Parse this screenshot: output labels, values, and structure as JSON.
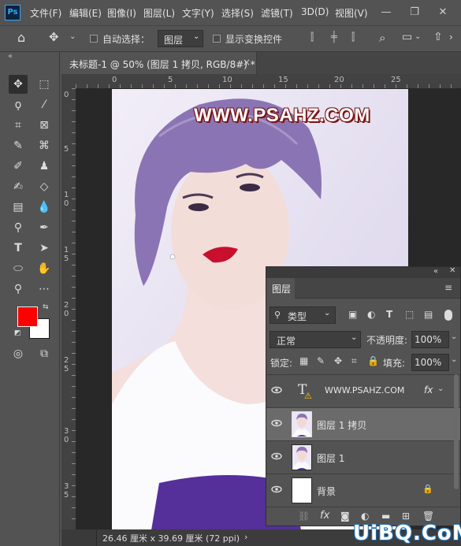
{
  "app": {
    "logo": "Ps"
  },
  "menu": [
    "文件(F)",
    "编辑(E)",
    "图像(I)",
    "图层(L)",
    "文字(Y)",
    "选择(S)",
    "滤镜(T)",
    "3D(D)",
    "视图(V)"
  ],
  "options_bar": {
    "auto_select_label": "自动选择：",
    "auto_select_value": "图层",
    "show_transform_label": "显示变换控件"
  },
  "document_tab": {
    "title": "未标题-1 @ 50% (图层 1 拷贝, RGB/8#) *",
    "close": "×"
  },
  "ruler": {
    "top_ticks": [
      "0",
      "5",
      "10",
      "15",
      "20",
      "25"
    ],
    "left_ticks": [
      "0",
      "5",
      "1 0",
      "1 5",
      "2 0",
      "2 5",
      "3 0",
      "3 5"
    ]
  },
  "watermark_text": "WWW.PSAHZ.COM",
  "status_bar": {
    "info": "26.46 厘米 x 39.69 厘米 (72 ppi)"
  },
  "colors": {
    "foreground": "#ff0000",
    "background": "#ffffff",
    "accent": "#31a8ff"
  },
  "layers_panel": {
    "title": "图层",
    "filter_kind": "类型",
    "blend_mode": "正常",
    "opacity_label": "不透明度:",
    "opacity_value": "100%",
    "lock_label": "锁定:",
    "fill_label": "填充:",
    "fill_value": "100%",
    "layers": [
      {
        "name": "WWW.PSAHZ.COM",
        "type": "text",
        "fx": "fx",
        "selected": false
      },
      {
        "name": "图层 1 拷贝",
        "type": "image",
        "selected": true
      },
      {
        "name": "图层 1",
        "type": "image",
        "selected": false
      },
      {
        "name": "背景",
        "type": "background",
        "selected": false,
        "locked": true
      }
    ],
    "bottom_icons": [
      "link-icon",
      "fx-icon",
      "mask-icon",
      "adjustment-icon",
      "folder-icon",
      "new-layer-icon",
      "trash-icon"
    ],
    "fx_label": "fx"
  },
  "site_watermark": {
    "text": "UiBQ.CoM"
  }
}
